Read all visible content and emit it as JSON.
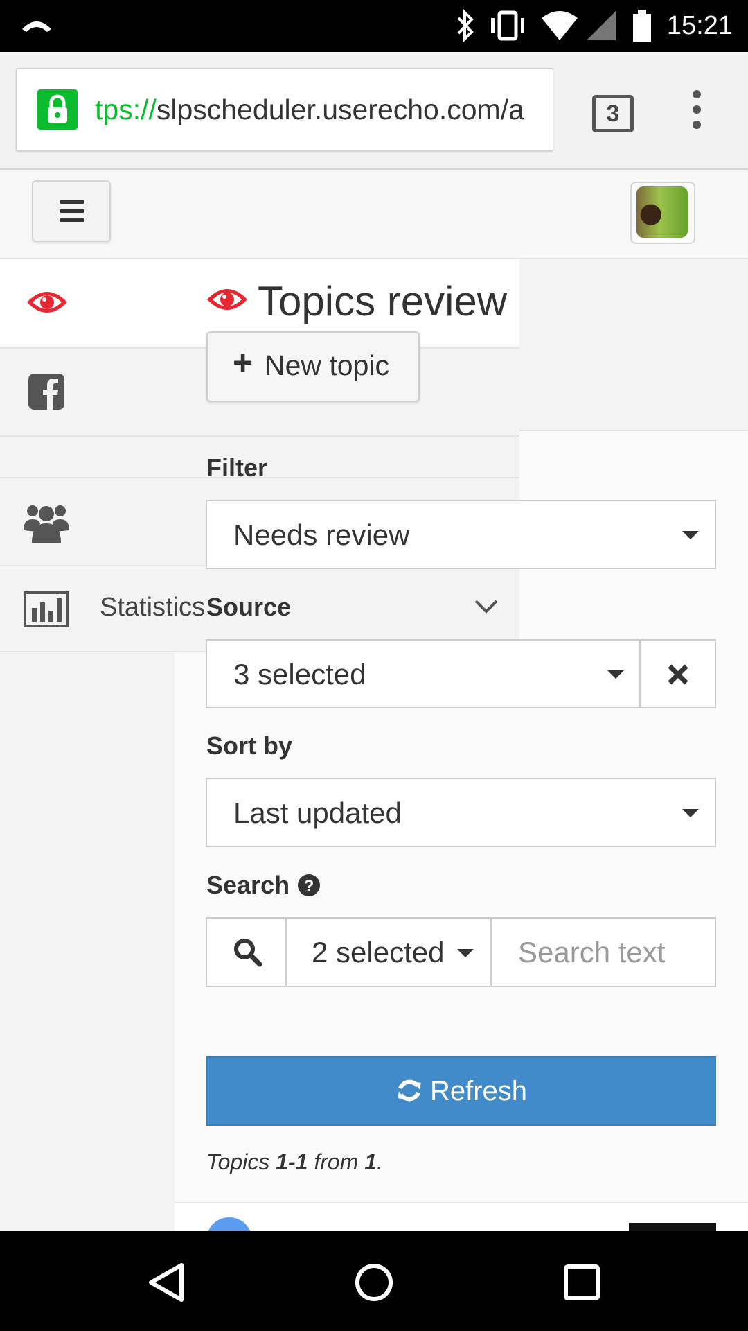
{
  "status_bar": {
    "time": "15:21"
  },
  "browser": {
    "url_scheme": "tps://",
    "url_rest": "slpscheduler.userecho.com/a",
    "tab_count": "3"
  },
  "sidebar": {
    "items": [
      {
        "icon": "eye-icon",
        "label": ""
      },
      {
        "icon": "facebook-icon",
        "label": ""
      },
      {
        "icon": "users-icon",
        "label": ""
      },
      {
        "icon": "bar-chart-icon",
        "label": "Statistics"
      }
    ]
  },
  "page": {
    "title": "Topics review",
    "new_topic_label": "New topic"
  },
  "filter": {
    "label": "Filter",
    "value": "Needs review"
  },
  "source": {
    "label": "Source",
    "value": "3 selected"
  },
  "sort": {
    "label": "Sort by",
    "value": "Last updated"
  },
  "search": {
    "label": "Search",
    "scope_value": "2 selected",
    "placeholder": "Search text"
  },
  "refresh": {
    "label": "Refresh"
  },
  "topics_count": {
    "prefix": "Topics ",
    "range": "1-1",
    "middle": " from ",
    "total": "1",
    "suffix": "."
  },
  "colors": {
    "accent_red": "#e8262f",
    "primary_blue": "#428bca",
    "secure_green": "#0bbc2f"
  }
}
